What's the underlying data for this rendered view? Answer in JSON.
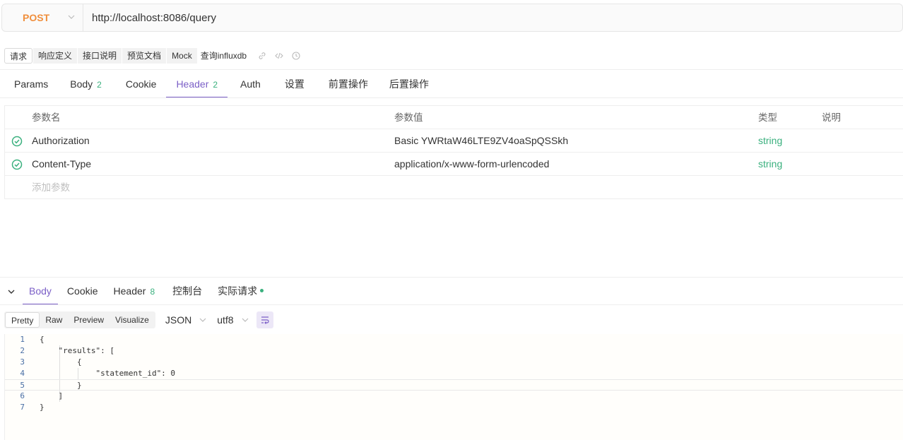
{
  "request": {
    "method": "POST",
    "url": "http://localhost:8086/query"
  },
  "doc_tabs": {
    "items": [
      "请求",
      "响应定义",
      "接口说明",
      "预览文档",
      "Mock"
    ],
    "name": "查询influxdb"
  },
  "request_tabs": [
    {
      "label": "Params",
      "count": ""
    },
    {
      "label": "Body",
      "count": "2"
    },
    {
      "label": "Cookie",
      "count": ""
    },
    {
      "label": "Header",
      "count": "2"
    },
    {
      "label": "Auth",
      "count": ""
    },
    {
      "label": "设置",
      "count": ""
    },
    {
      "label": "前置操作",
      "count": ""
    },
    {
      "label": "后置操作",
      "count": ""
    }
  ],
  "header_table": {
    "columns": {
      "name": "参数名",
      "value": "参数值",
      "type": "类型",
      "desc": "说明"
    },
    "rows": [
      {
        "name": "Authorization",
        "value": "Basic YWRtaW46LTE9ZV4oaSpQSSkh",
        "type": "string",
        "desc": ""
      },
      {
        "name": "Content-Type",
        "value": "application/x-www-form-urlencoded",
        "type": "string",
        "desc": ""
      }
    ],
    "add_placeholder": "添加参数"
  },
  "response_tabs": [
    {
      "label": "Body",
      "count": ""
    },
    {
      "label": "Cookie",
      "count": ""
    },
    {
      "label": "Header",
      "count": "8"
    },
    {
      "label": "控制台",
      "count": ""
    },
    {
      "label": "实际请求",
      "count": ""
    }
  ],
  "view_modes": [
    "Pretty",
    "Raw",
    "Preview",
    "Visualize"
  ],
  "format": "JSON",
  "encoding": "utf8",
  "code_lines": [
    {
      "n": "1",
      "text": "{"
    },
    {
      "n": "2",
      "text": "    \"results\": ["
    },
    {
      "n": "3",
      "text": "        {"
    },
    {
      "n": "4",
      "text": "            \"statement_id\": 0"
    },
    {
      "n": "5",
      "text": "        }"
    },
    {
      "n": "6",
      "text": "    ]"
    },
    {
      "n": "7",
      "text": "}"
    }
  ],
  "colors": {
    "accent": "#7b5fc7",
    "method": "#f08f3d",
    "success": "#3ab07e"
  }
}
